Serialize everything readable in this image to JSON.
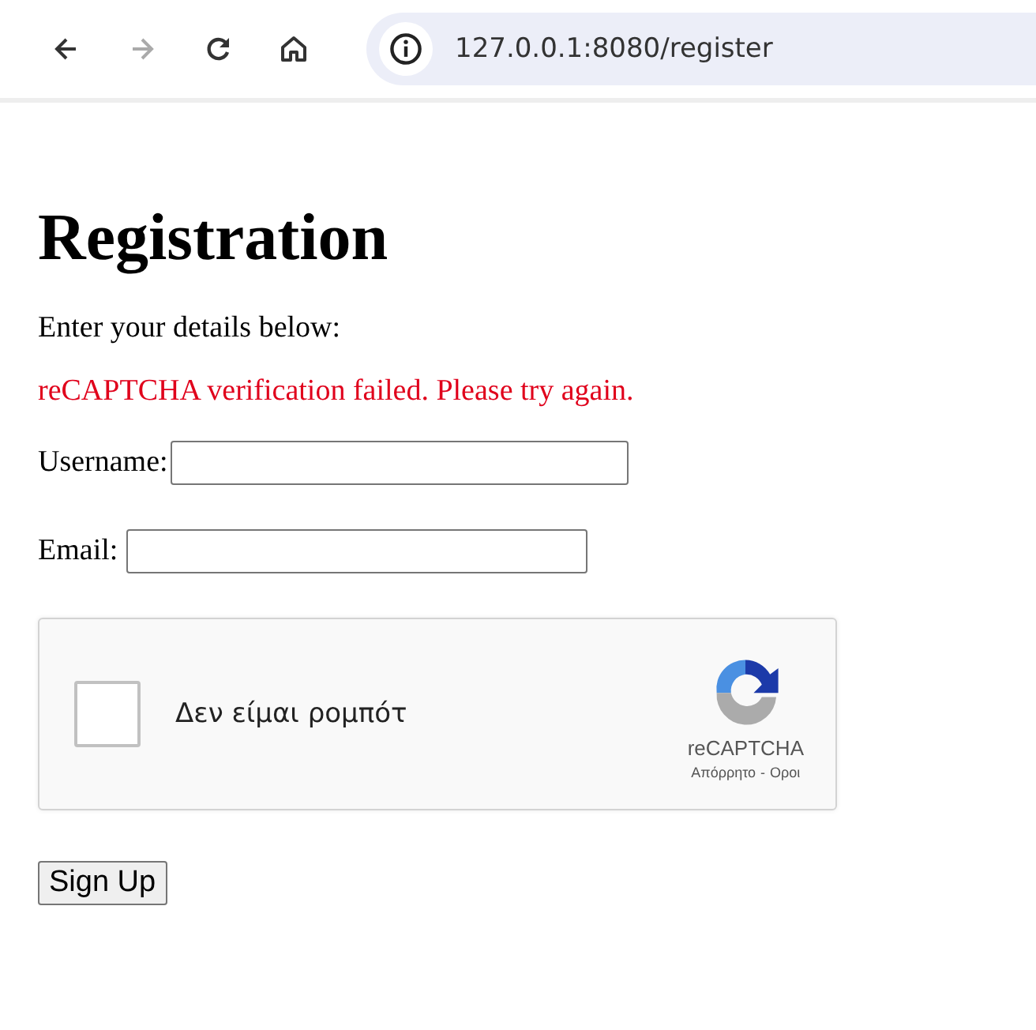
{
  "browser": {
    "url": "127.0.0.1:8080/register",
    "forward_disabled": true
  },
  "page": {
    "title": "Registration",
    "intro": "Enter your details below:",
    "error": "reCAPTCHA verification failed. Please try again.",
    "fields": [
      {
        "label": "Username:",
        "kind": "text"
      },
      {
        "label": "Email:",
        "kind": "email"
      }
    ],
    "captcha": {
      "checked": false,
      "label": "Δεν είμαι ρομπότ",
      "brand": "reCAPTCHA",
      "links": [
        "Απόρρητο",
        "Οροι"
      ],
      "separator": "-"
    },
    "submit": "Sign Up"
  }
}
